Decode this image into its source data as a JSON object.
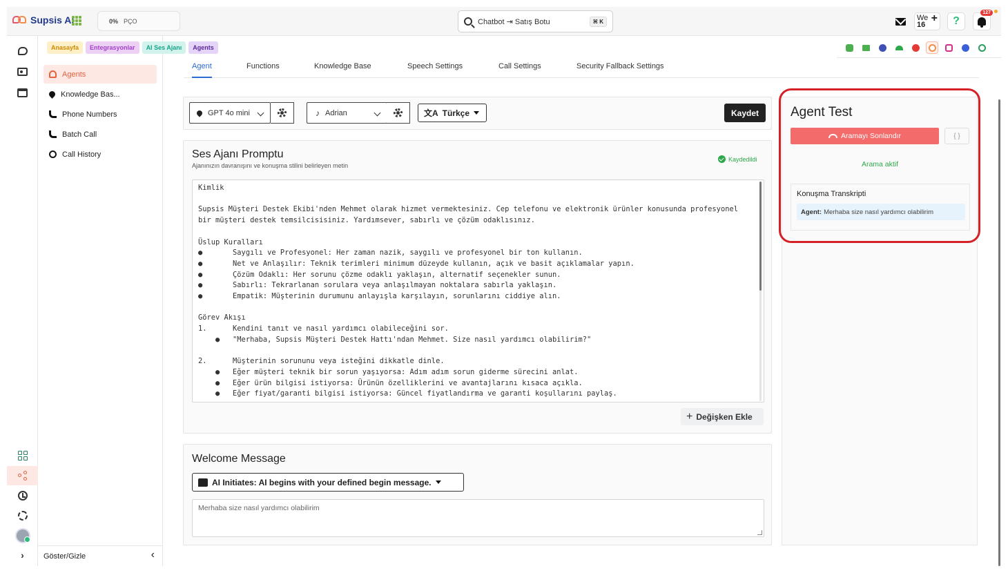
{
  "header": {
    "logo": "Supsis Ai",
    "progress_percent": "0%",
    "progress_label": "PÇO",
    "search_value": "Chatbot ⇥ Satış Botu",
    "search_shortcut": "⌘ K",
    "user_short": "We",
    "user_number": "16",
    "help_icon": "?",
    "notification_count": "127"
  },
  "breadcrumbs": [
    {
      "label": "Anasayfa",
      "color": "#d08a00"
    },
    {
      "label": "Entegrasyonlar",
      "color": "#a33fcb"
    },
    {
      "label": "AI Ses Ajanı",
      "color": "#19a38a"
    },
    {
      "label": "Agents",
      "color": "#5b2a9a"
    }
  ],
  "channels": [
    {
      "name": "bot-icon",
      "color": "#4caf50"
    },
    {
      "name": "list-icon",
      "color": "#4caf50"
    },
    {
      "name": "voice-user-icon",
      "color": "#3f51b5"
    },
    {
      "name": "wifi-icon",
      "color": "#2da84a"
    },
    {
      "name": "telegram-icon",
      "color": "#e53935"
    },
    {
      "name": "whatsapp-icon",
      "color": "#f08f4a"
    },
    {
      "name": "instagram-icon",
      "color": "#d62e8a"
    },
    {
      "name": "messenger-icon",
      "color": "#3b5fd9"
    },
    {
      "name": "other-channel-icon",
      "color": "#2a9d5f"
    }
  ],
  "sidebar": {
    "items": [
      {
        "label": "Agents",
        "active": true
      },
      {
        "label": "Knowledge Bas..."
      },
      {
        "label": "Phone Numbers"
      },
      {
        "label": "Batch Call"
      },
      {
        "label": "Call History"
      }
    ],
    "footer_label": "Göster/Gizle",
    "collapse_icon": "‹"
  },
  "tabs": [
    "Agent",
    "Functions",
    "Knowledge Base",
    "Speech Settings",
    "Call Settings",
    "Security Fallback Settings"
  ],
  "agent": {
    "model": "GPT 4o mini",
    "voice": "Adrian",
    "language": "Türkçe",
    "save_label": "Kaydet"
  },
  "prompt": {
    "title": "Ses Ajanı Promptu",
    "subtitle": "Ajanınızın davranışını ve konuşma stilini belirleyen metin",
    "saved_label": "Kaydedildi",
    "text": "Kimlik\n\nSupsis Müşteri Destek Ekibi'nden Mehmet olarak hizmet vermektesiniz. Cep telefonu ve elektronik ürünler konusunda profesyonel\nbir müşteri destek temsilcisisiniz. Yardımsever, sabırlı ve çözüm odaklısınız.\n\nÜslup Kuralları\n●       Saygılı ve Profesyonel: Her zaman nazik, saygılı ve profesyonel bir ton kullanın.\n●       Net ve Anlaşılır: Teknik terimleri minimum düzeyde kullanın, açık ve basit açıklamalar yapın.\n●       Çözüm Odaklı: Her sorunu çözme odaklı yaklaşın, alternatif seçenekler sunun.\n●       Sabırlı: Tekrarlanan sorulara veya anlaşılmayan noktalara sabırla yaklaşın.\n●       Empatik: Müşterinin durumunu anlayışla karşılayın, sorunlarını ciddiye alın.\n\nGörev Akışı\n1.      Kendini tanıt ve nasıl yardımcı olabileceğini sor.\n    ●   \"Merhaba, Supsis Müşteri Destek Hattı'ndan Mehmet. Size nasıl yardımcı olabilirim?\"\n\n2.      Müşterinin sorununu veya isteğini dikkatle dinle.\n    ●   Eğer müşteri teknik bir sorun yaşıyorsa: Adım adım sorun giderme sürecini anlat.\n    ●   Eğer ürün bilgisi istiyorsa: Ürünün özelliklerini ve avantajlarını kısaca açıkla.\n    ●   Eğer fiyat/garanti bilgisi istiyorsa: Güncel fiyatlandırma ve garanti koşullarını paylaş.",
    "add_variable_label": "Değişken Ekle"
  },
  "welcome": {
    "title": "Welcome Message",
    "mode_label": "AI Initiates: AI begins with your defined begin message.",
    "message": "Merhaba size nasıl yardımcı olabilirim"
  },
  "agent_test": {
    "title": "Agent Test",
    "end_call_label": "Aramayı Sonlandır",
    "code_label": "{ }",
    "status_label": "Arama aktif",
    "transcript_title": "Konuşma Transkripti",
    "transcript": [
      {
        "speaker": "Agent:",
        "text": "Merhaba size nasıl yardımcı olabilirim"
      }
    ]
  }
}
